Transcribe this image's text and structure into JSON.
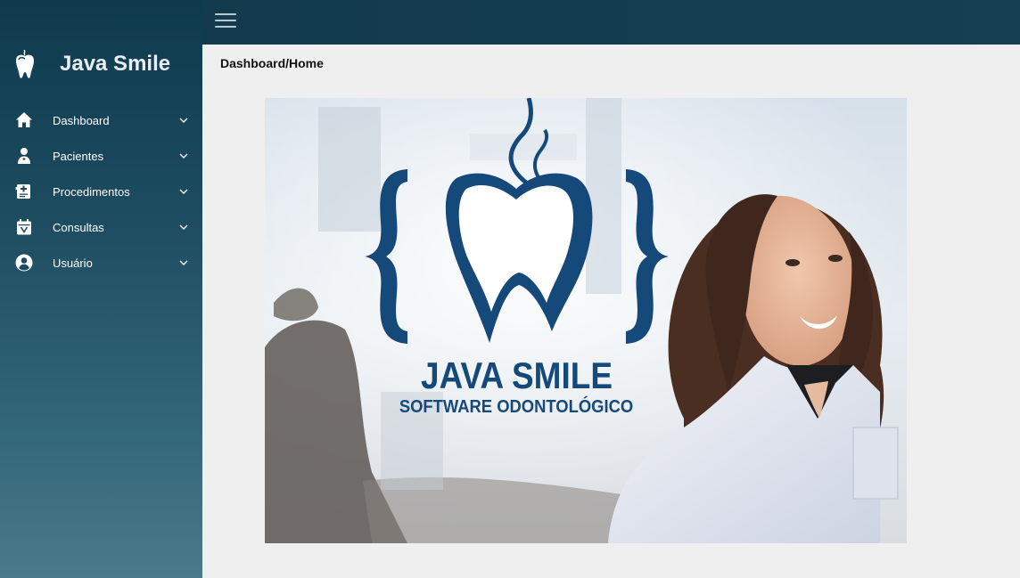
{
  "app": {
    "name": "Java Smile"
  },
  "topbar": {
    "menu_toggle_icon": "hamburger-icon"
  },
  "breadcrumb": "Dashboard/Home",
  "sidebar": {
    "items": [
      {
        "label": "Dashboard",
        "icon": "home-icon"
      },
      {
        "label": "Pacientes",
        "icon": "patient-icon"
      },
      {
        "label": "Procedimentos",
        "icon": "procedure-icon"
      },
      {
        "label": "Consultas",
        "icon": "calendar-icon"
      },
      {
        "label": "Usuário",
        "icon": "user-icon"
      }
    ]
  },
  "banner": {
    "title": "JAVA SMILE",
    "subtitle": "SOFTWARE ODONTOLÓGICO"
  },
  "colors": {
    "sidebar_top": "#0f3a4e",
    "sidebar_bottom": "#4a7a8a",
    "topbar": "#133a4d",
    "brand_blue": "#15497a",
    "page_bg": "#efefef"
  }
}
